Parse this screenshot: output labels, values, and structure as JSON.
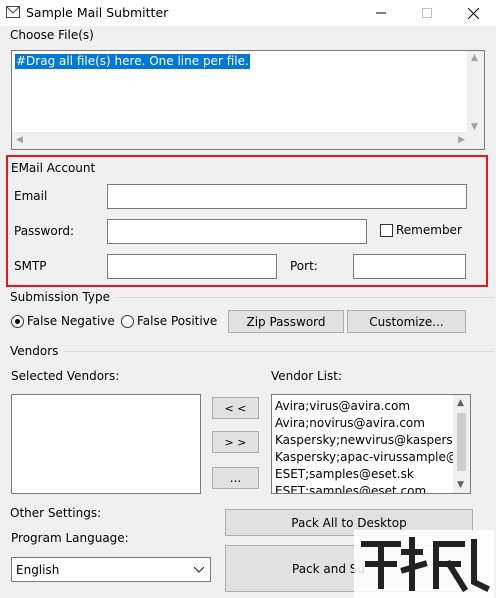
{
  "window": {
    "title": "Sample Mail Submitter",
    "minimize": "—",
    "maximize": "☐",
    "close": "✕"
  },
  "files": {
    "group_label": "Choose File(s)",
    "textarea_value": "#Drag all file(s) here. One line per file."
  },
  "account": {
    "group_label": "EMail Account",
    "email_label": "Email",
    "email_value": "",
    "password_label": "Password:",
    "password_value": "",
    "remember_label": "Remember",
    "remember_checked": false,
    "smtp_label": "SMTP",
    "smtp_value": "",
    "port_label": "Port:",
    "port_value": ""
  },
  "submission": {
    "group_label": "Submission Type",
    "false_negative_label": "False Negative",
    "false_positive_label": "False Positive",
    "selected": "false_negative",
    "zip_password_label": "Zip Password",
    "customize_label": "Customize..."
  },
  "vendors": {
    "group_label": "Vendors",
    "selected_label": "Selected Vendors:",
    "list_label": "Vendor List:",
    "add_all_label": "< <",
    "remove_all_label": "> >",
    "more_label": "...",
    "selected_items": [],
    "vendor_items": [
      "Avira;virus@avira.com",
      "Avira;novirus@avira.com",
      "Kaspersky;newvirus@kaspersk",
      "Kaspersky;apac-virussample@",
      "ESET;samples@eset.sk",
      "ESET;samples@eset.com"
    ]
  },
  "settings": {
    "group_label": "Other Settings:",
    "language_label": "Program Language:",
    "language_value": "English",
    "pack_desktop_label": "Pack All to Desktop",
    "pack_send_label": "Pack and Su"
  },
  "colors": {
    "highlight": "#e8151b",
    "selection": "#0078d7"
  }
}
